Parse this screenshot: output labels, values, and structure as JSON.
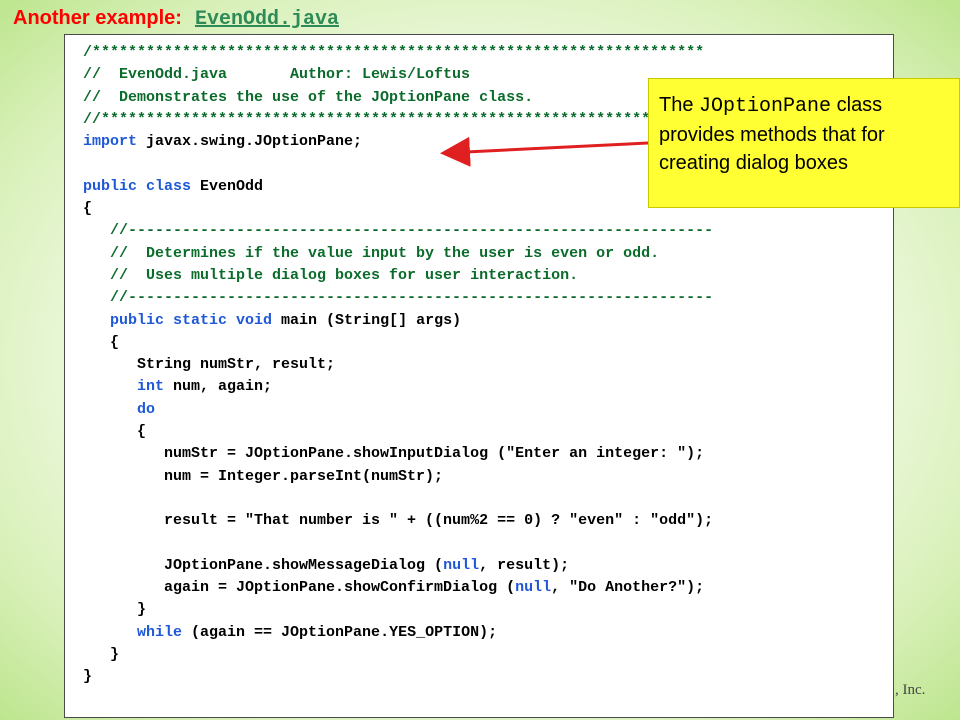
{
  "header": {
    "label": "Another example:",
    "filename": "EvenOdd.java"
  },
  "code_lines": [
    [
      {
        "t": "/********************************************************************",
        "c": "comment"
      }
    ],
    [
      {
        "t": "//  EvenOdd.java       Author: Lewis/Loftus",
        "c": "comment"
      }
    ],
    [
      {
        "t": "//  Demonstrates the use of the JOptionPane class.",
        "c": "comment"
      }
    ],
    [
      {
        "t": "//********************************************************************",
        "c": "comment"
      }
    ],
    [
      {
        "t": "import",
        "c": "kw"
      },
      {
        "t": " javax.swing.JOptionPane;",
        "c": "plain"
      }
    ],
    [
      {
        "t": "",
        "c": "plain"
      }
    ],
    [
      {
        "t": "public class",
        "c": "kw"
      },
      {
        "t": " EvenOdd",
        "c": "plain"
      }
    ],
    [
      {
        "t": "{",
        "c": "plain"
      }
    ],
    [
      {
        "t": "   //-----------------------------------------------------------------",
        "c": "comment"
      }
    ],
    [
      {
        "t": "   //  Determines if the value input by the user is even or odd.",
        "c": "comment"
      }
    ],
    [
      {
        "t": "   //  Uses multiple dialog boxes for user interaction.",
        "c": "comment"
      }
    ],
    [
      {
        "t": "   //-----------------------------------------------------------------",
        "c": "comment"
      }
    ],
    [
      {
        "t": "   ",
        "c": "plain"
      },
      {
        "t": "public static void",
        "c": "kw"
      },
      {
        "t": " main (String[] args)",
        "c": "plain"
      }
    ],
    [
      {
        "t": "   {",
        "c": "plain"
      }
    ],
    [
      {
        "t": "      String numStr, result;",
        "c": "plain"
      }
    ],
    [
      {
        "t": "      ",
        "c": "plain"
      },
      {
        "t": "int",
        "c": "kw"
      },
      {
        "t": " num, again;",
        "c": "plain"
      }
    ],
    [
      {
        "t": "      ",
        "c": "plain"
      },
      {
        "t": "do",
        "c": "kw"
      }
    ],
    [
      {
        "t": "      {",
        "c": "plain"
      }
    ],
    [
      {
        "t": "         numStr = JOptionPane.showInputDialog (\"Enter an integer: \");",
        "c": "plain"
      }
    ],
    [
      {
        "t": "         num = Integer.parseInt(numStr);",
        "c": "plain"
      }
    ],
    [
      {
        "t": "",
        "c": "plain"
      }
    ],
    [
      {
        "t": "         result = \"That number is \" + ((num%2 == 0) ? \"even\" : \"odd\");",
        "c": "plain"
      }
    ],
    [
      {
        "t": "",
        "c": "plain"
      }
    ],
    [
      {
        "t": "         JOptionPane.showMessageDialog (",
        "c": "plain"
      },
      {
        "t": "null",
        "c": "kw"
      },
      {
        "t": ", result);",
        "c": "plain"
      }
    ],
    [
      {
        "t": "         again = JOptionPane.showConfirmDialog (",
        "c": "plain"
      },
      {
        "t": "null",
        "c": "kw"
      },
      {
        "t": ", \"Do Another?\");",
        "c": "plain"
      }
    ],
    [
      {
        "t": "      }",
        "c": "plain"
      }
    ],
    [
      {
        "t": "      ",
        "c": "plain"
      },
      {
        "t": "while",
        "c": "kw"
      },
      {
        "t": " (again == JOptionPane.YES_OPTION);",
        "c": "plain"
      }
    ],
    [
      {
        "t": "   }",
        "c": "plain"
      }
    ],
    [
      {
        "t": "}",
        "c": "plain"
      }
    ]
  ],
  "callout": {
    "text_before": "The ",
    "code": "JOptionPane",
    "text_after": " class provides methods that for creating dialog boxes"
  },
  "footer": {
    "copyright_fragment": ", Inc."
  },
  "colors": {
    "title_label": "#ff0000",
    "title_file": "#2e8b57",
    "comment": "#0b6b2b",
    "keyword": "#1f58d6",
    "callout_bg": "#ffff33",
    "arrow": "#e02020"
  }
}
